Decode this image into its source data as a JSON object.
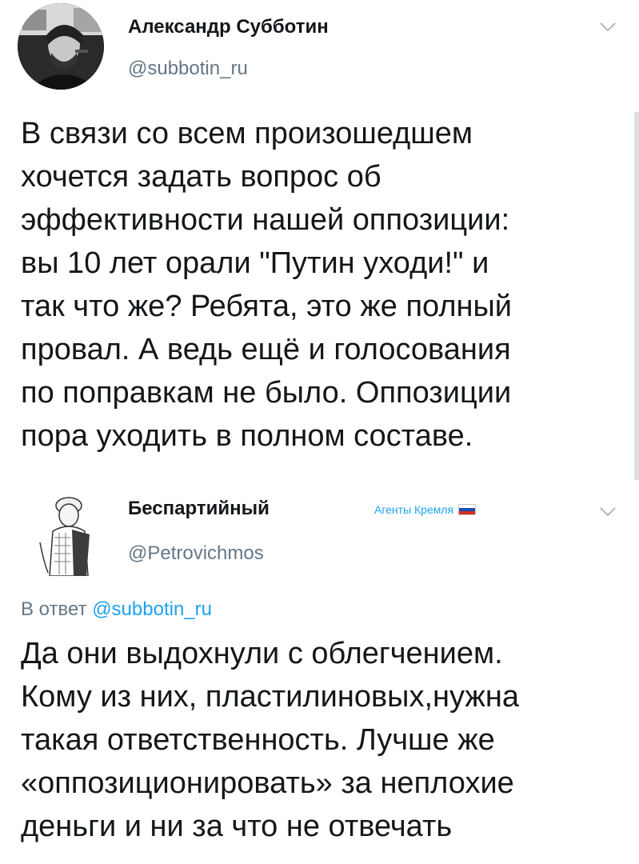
{
  "tweet": {
    "author_name": "Александр Субботин",
    "author_handle": "@subbotin_ru",
    "text": "В связи со всем произошедшем\nхочется задать вопрос об\nэффективности нашей оппозиции:\nвы 10 лет орали \"Путин уходи!\" и\nтак что же? Ребята, это же полный\nпровал. А ведь ещё и голосования\nпо поправкам не было. Оппозиции\nпора уходить в полном составе."
  },
  "reply": {
    "author_name": "Беспартийный",
    "author_handle": "@Petrovichmos",
    "badge_text": "Агенты Кремля",
    "reply_prefix": "В ответ",
    "reply_to": "@subbotin_ru",
    "text": "Да они выдохнули с облегчением.\nКому из них, пластилиновых,нужна\nтакая ответственность. Лучше же\n«оппозиционировать» за неплохие\nденьги и ни за что не отвечать"
  },
  "colors": {
    "text": "#14171a",
    "secondary": "#657786",
    "accent": "#1da1f2"
  },
  "icons": {
    "menu": "chevron-down-icon",
    "flag": "russian-flag-icon"
  }
}
